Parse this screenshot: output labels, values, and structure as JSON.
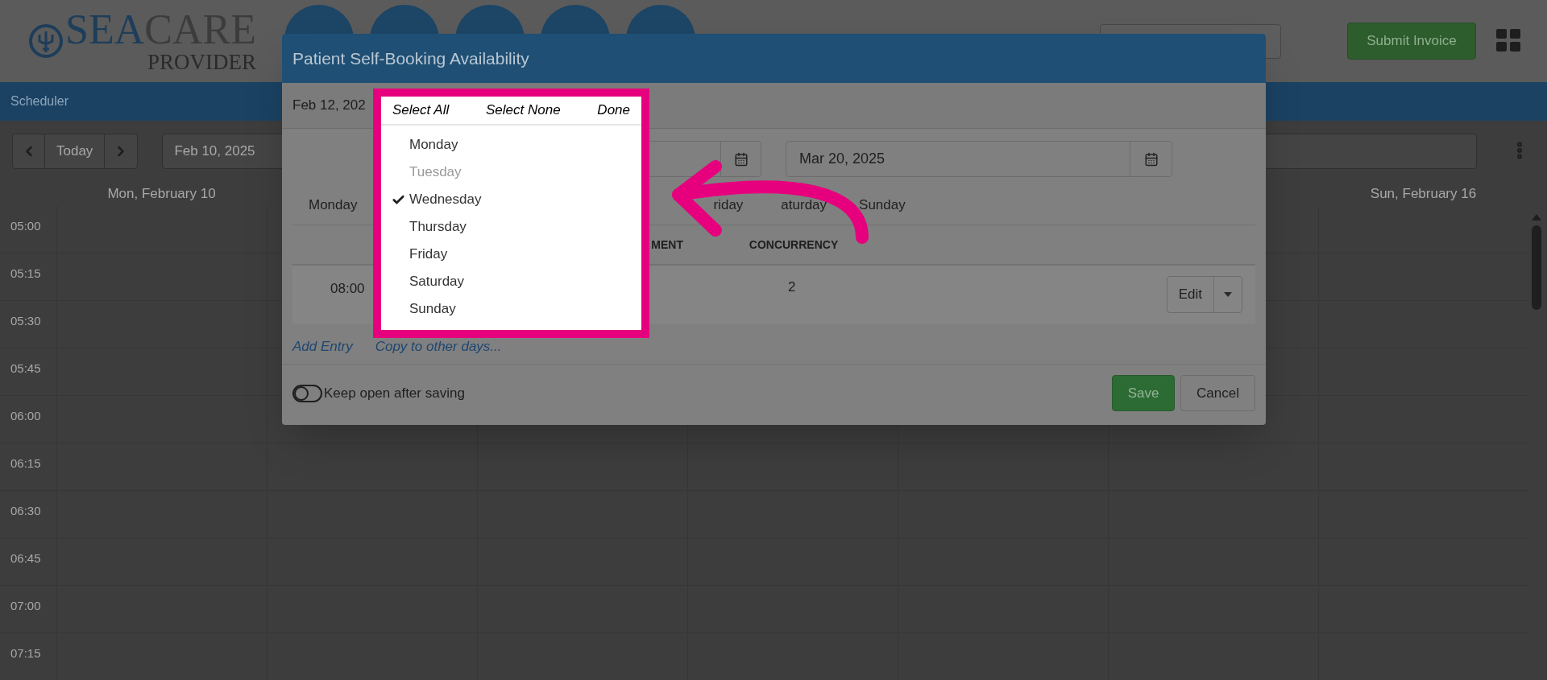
{
  "header": {
    "logo": {
      "first_word": "SEA",
      "second_word": "CARE",
      "tagline": "PROVIDER"
    },
    "submit_button": "Submit Invoice"
  },
  "section_bar": {
    "title": "Scheduler"
  },
  "toolbar": {
    "today_button": "Today",
    "date_field": "Feb 10, 2025"
  },
  "calendar": {
    "first_day": "Mon, February 10",
    "last_day": "Sun, February 16",
    "times": [
      "05:00",
      "05:15",
      "05:30",
      "05:45",
      "06:00",
      "06:15",
      "06:30",
      "06:45",
      "07:00",
      "07:15"
    ]
  },
  "modal": {
    "title": "Patient Self-Booking Availability",
    "date_label": "Feb 12, 202",
    "end_date": "Mar 20, 2025",
    "day_tabs": [
      "Monday",
      "riday",
      "aturday",
      "Sunday"
    ],
    "table": {
      "columns": [
        "MENT",
        "CONCURRENCY"
      ],
      "rows": [
        {
          "time": "08:00",
          "concurrency": "2",
          "action": "Edit"
        }
      ]
    },
    "links": [
      "Add Entry",
      "Copy to other days..."
    ],
    "keep_open": {
      "label": "Keep open after saving",
      "on": false
    },
    "buttons": {
      "save": "Save",
      "cancel": "Cancel"
    }
  },
  "day_picker": {
    "actions": [
      "Select All",
      "Select None",
      "Done"
    ],
    "days": [
      {
        "label": "Monday",
        "checked": false,
        "disabled": false
      },
      {
        "label": "Tuesday",
        "checked": false,
        "disabled": true
      },
      {
        "label": "Wednesday",
        "checked": true,
        "disabled": false
      },
      {
        "label": "Thursday",
        "checked": false,
        "disabled": false
      },
      {
        "label": "Friday",
        "checked": false,
        "disabled": false
      },
      {
        "label": "Saturday",
        "checked": false,
        "disabled": false
      },
      {
        "label": "Sunday",
        "checked": false,
        "disabled": false
      }
    ]
  }
}
